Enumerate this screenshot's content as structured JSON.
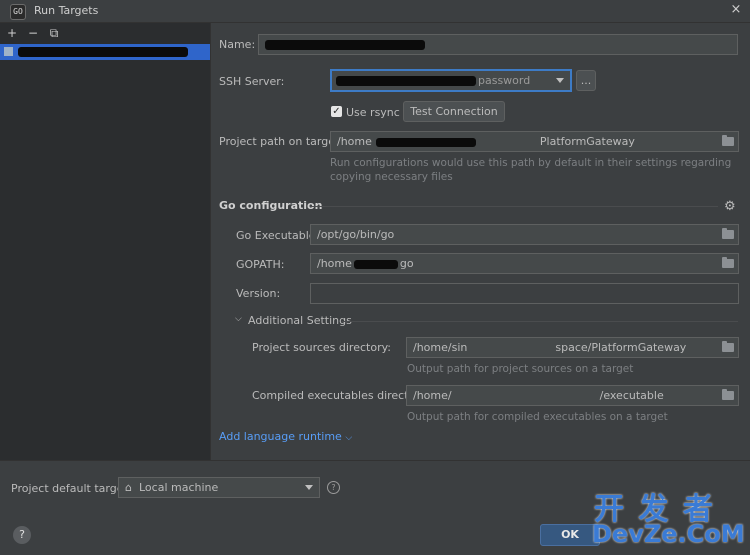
{
  "window": {
    "title": "Run Targets",
    "close_icon": "×"
  },
  "left": {
    "add_icon": "+",
    "remove_icon": "−",
    "copy_icon": "⧉",
    "selected_target": ""
  },
  "form": {
    "name_label": "Name:",
    "name_value": "",
    "ssh_label": "SSH Server:",
    "ssh_value": "password",
    "ssh_more": "...",
    "rsync_label": "Use rsync",
    "rsync_checked": true,
    "test_connection": "Test Connection",
    "path_label": "Project path on target:",
    "path_value_prefix": "/home",
    "path_value_suffix": "PlatformGateway",
    "path_hint": "Run configurations would use this path by default in their settings regarding copying necessary files"
  },
  "go": {
    "section": "Go configuration",
    "exec_label": "Go Executable:",
    "exec_value": "/opt/go/bin/go",
    "gopath_label": "GOPATH:",
    "gopath_value_prefix": "/home",
    "gopath_value_suffix": "go",
    "version_label": "Version:",
    "version_value": "",
    "additional": "Additional Settings",
    "sources_label": "Project sources directory:",
    "sources_value_prefix": "/home/sin",
    "sources_value_suffix": "space/PlatformGateway",
    "sources_hint": "Output path for project sources on a target",
    "compiled_label": "Compiled executables directory:",
    "compiled_value_prefix": "/home/",
    "compiled_value_suffix": "/executable",
    "compiled_hint": "Output path for compiled executables on a target",
    "add_runtime": "Add language runtime"
  },
  "bottom": {
    "default_label": "Project default target:",
    "default_value": "Local machine",
    "help": "?",
    "ok": "OK"
  },
  "watermark": {
    "line1": "开 发 者",
    "line2": "DevZe.CoM"
  }
}
